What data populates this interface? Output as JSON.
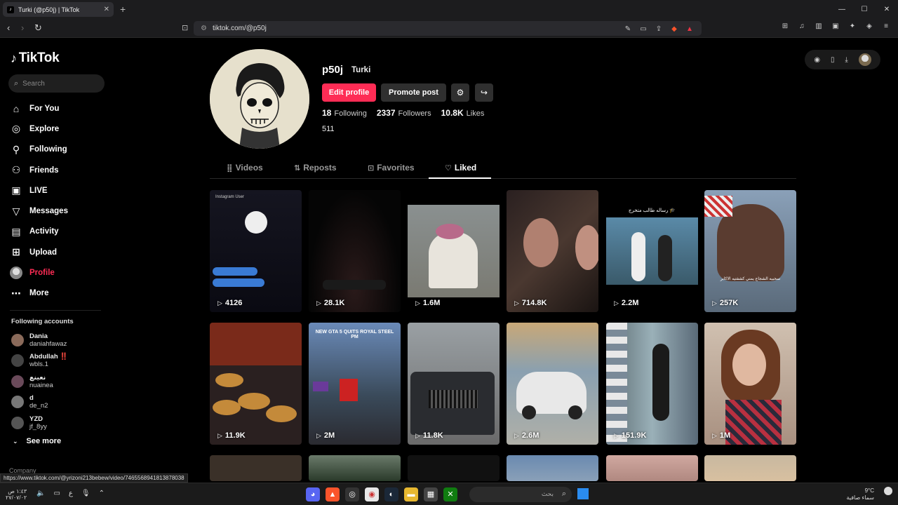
{
  "browser": {
    "tab_title": "Turki (@p50j) | TikTok",
    "url": "tiktok.com/@p50j",
    "new_tab": "+",
    "minimize": "—",
    "maximize": "☐",
    "close": "✕"
  },
  "sidebar": {
    "logo": "TikTok",
    "search_placeholder": "Search",
    "menu": [
      {
        "label": "For You",
        "icon": "home-icon"
      },
      {
        "label": "Explore",
        "icon": "compass-icon"
      },
      {
        "label": "Following",
        "icon": "following-icon"
      },
      {
        "label": "Friends",
        "icon": "friends-icon"
      },
      {
        "label": "LIVE",
        "icon": "live-icon"
      },
      {
        "label": "Messages",
        "icon": "messages-icon"
      },
      {
        "label": "Activity",
        "icon": "activity-icon"
      },
      {
        "label": "Upload",
        "icon": "upload-icon"
      },
      {
        "label": "Profile",
        "icon": "profile-avatar"
      },
      {
        "label": "More",
        "icon": "more-icon"
      }
    ],
    "following_title": "Following accounts",
    "following": [
      {
        "name": "Dania",
        "handle": "daniahfawaz"
      },
      {
        "name": "Abdullah ‼️",
        "handle": "wbls.1"
      },
      {
        "name": "نعينع",
        "handle": "nuainea"
      },
      {
        "name": "d",
        "handle": "de_n2"
      },
      {
        "name": "YZD",
        "handle": "jf_8yy"
      }
    ],
    "see_more": "See more",
    "company": "Company"
  },
  "profile": {
    "username": "p50j",
    "nickname": "Turki",
    "edit_label": "Edit profile",
    "promote_label": "Promote post",
    "following_count": "18",
    "following_label": "Following",
    "followers_count": "2337",
    "followers_label": "Followers",
    "likes_count": "10.8K",
    "likes_label": "Likes",
    "bio": "511"
  },
  "tabs": [
    {
      "label": "Videos",
      "icon": "grid-icon"
    },
    {
      "label": "Reposts",
      "icon": "repost-icon"
    },
    {
      "label": "Favorites",
      "icon": "bookmark-icon"
    },
    {
      "label": "Liked",
      "icon": "heart-icon",
      "active": true
    }
  ],
  "videos": [
    {
      "views": "4126",
      "theme": "#1a1a22"
    },
    {
      "views": "28.1K",
      "theme": "#0d0d0d"
    },
    {
      "views": "1.6M",
      "theme": "#8c8c84"
    },
    {
      "views": "714.8K",
      "theme": "#3a2a22"
    },
    {
      "views": "2.2M",
      "theme": "#4a6a7a"
    },
    {
      "views": "257K",
      "theme": "#6a7a8a"
    },
    {
      "views": "11.9K",
      "theme": "#7a3a2a"
    },
    {
      "views": "2M",
      "theme": "#4a6a9a"
    },
    {
      "views": "11.8K",
      "theme": "#8a8a8a"
    },
    {
      "views": "2.6M",
      "theme": "#b0a48a"
    },
    {
      "views": "151.9K",
      "theme": "#6a7a7a"
    },
    {
      "views": "1M",
      "theme": "#c4b09a"
    },
    {
      "views": "",
      "theme": "#3a3028"
    },
    {
      "views": "",
      "theme": "#2a3a2a"
    },
    {
      "views": "",
      "theme": "#1a1a1a"
    },
    {
      "views": "",
      "theme": "#6a8ab0"
    },
    {
      "views": "",
      "theme": "#c0a090"
    },
    {
      "views": "",
      "theme": "#d0b898"
    }
  ],
  "status_link": "https://www.tiktok.com/@yrizoni213bebew/video/7465568941813878038",
  "taskbar": {
    "time": "١:٤٣ ص",
    "date": "٢٧/٠٧/٠٢",
    "search": "بحث",
    "temp": "9°C",
    "weather": "سماء صافية"
  },
  "overlay_texts": {
    "v1_header": "Instagram User",
    "v1_count": "4126",
    "v5_caption": "رساله طالب متخرج 🎓",
    "v6_caption": "سحبيه الشجاع يمني كشفتيه الاكابر",
    "v8_caption": "NEW GTA 5 QUITS ROYAL STEEL PM"
  }
}
